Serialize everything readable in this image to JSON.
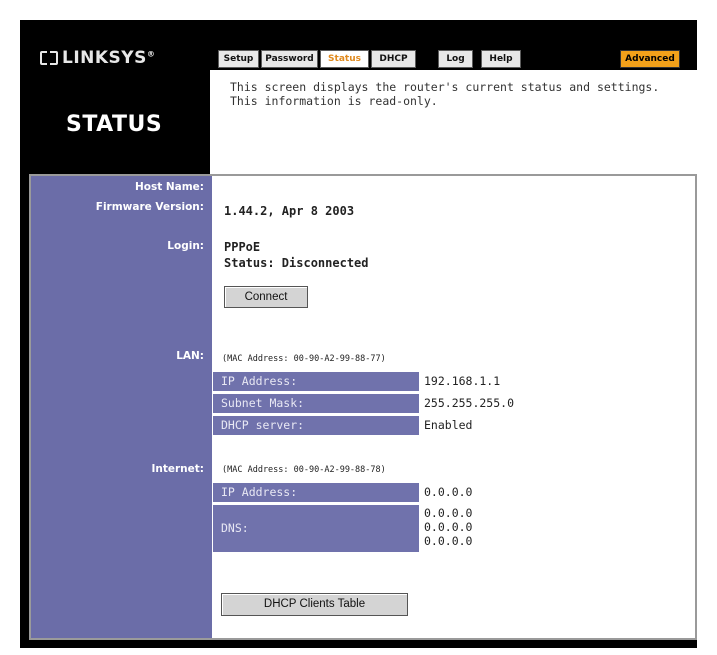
{
  "brand": {
    "logo_text": "LINKSYS",
    "trademark": "®"
  },
  "page": {
    "title": "STATUS",
    "description": "This screen displays the router's current status and settings. This information is read-only."
  },
  "tabs": [
    {
      "label": "Setup",
      "active": false
    },
    {
      "label": "Password",
      "active": false
    },
    {
      "label": "Status",
      "active": true
    },
    {
      "label": "DHCP",
      "active": false
    },
    {
      "label": "Log",
      "active": false
    },
    {
      "label": "Help",
      "active": false
    },
    {
      "label": "Advanced",
      "active": false
    }
  ],
  "status": {
    "host_name_label": "Host Name:",
    "host_name_value": "",
    "firmware_label": "Firmware Version:",
    "firmware_value": "1.44.2, Apr 8 2003",
    "login_label": "Login:",
    "login_type": "PPPoE",
    "login_status": "Status: Disconnected",
    "connect_button": "Connect"
  },
  "lan": {
    "label": "LAN:",
    "mac": "(MAC Address: 00-90-A2-99-88-77)",
    "rows": [
      {
        "key": "IP Address:",
        "value": "192.168.1.1"
      },
      {
        "key": "Subnet Mask:",
        "value": "255.255.255.0"
      },
      {
        "key": "DHCP server:",
        "value": "Enabled"
      }
    ]
  },
  "internet": {
    "label": "Internet:",
    "mac": "(MAC Address: 00-90-A2-99-88-78)",
    "ip_key": "IP Address:",
    "ip_value": "0.0.0.0",
    "dns_key": "DNS:",
    "dns_values": [
      "0.0.0.0",
      "0.0.0.0",
      "0.0.0.0"
    ]
  },
  "dhcp_clients_button": "DHCP Clients Table",
  "colors": {
    "sidebar": "#6b6da8",
    "cell": "#7072ac",
    "active_tab": "#e08a1e",
    "advanced_tab": "#f3a11a"
  }
}
